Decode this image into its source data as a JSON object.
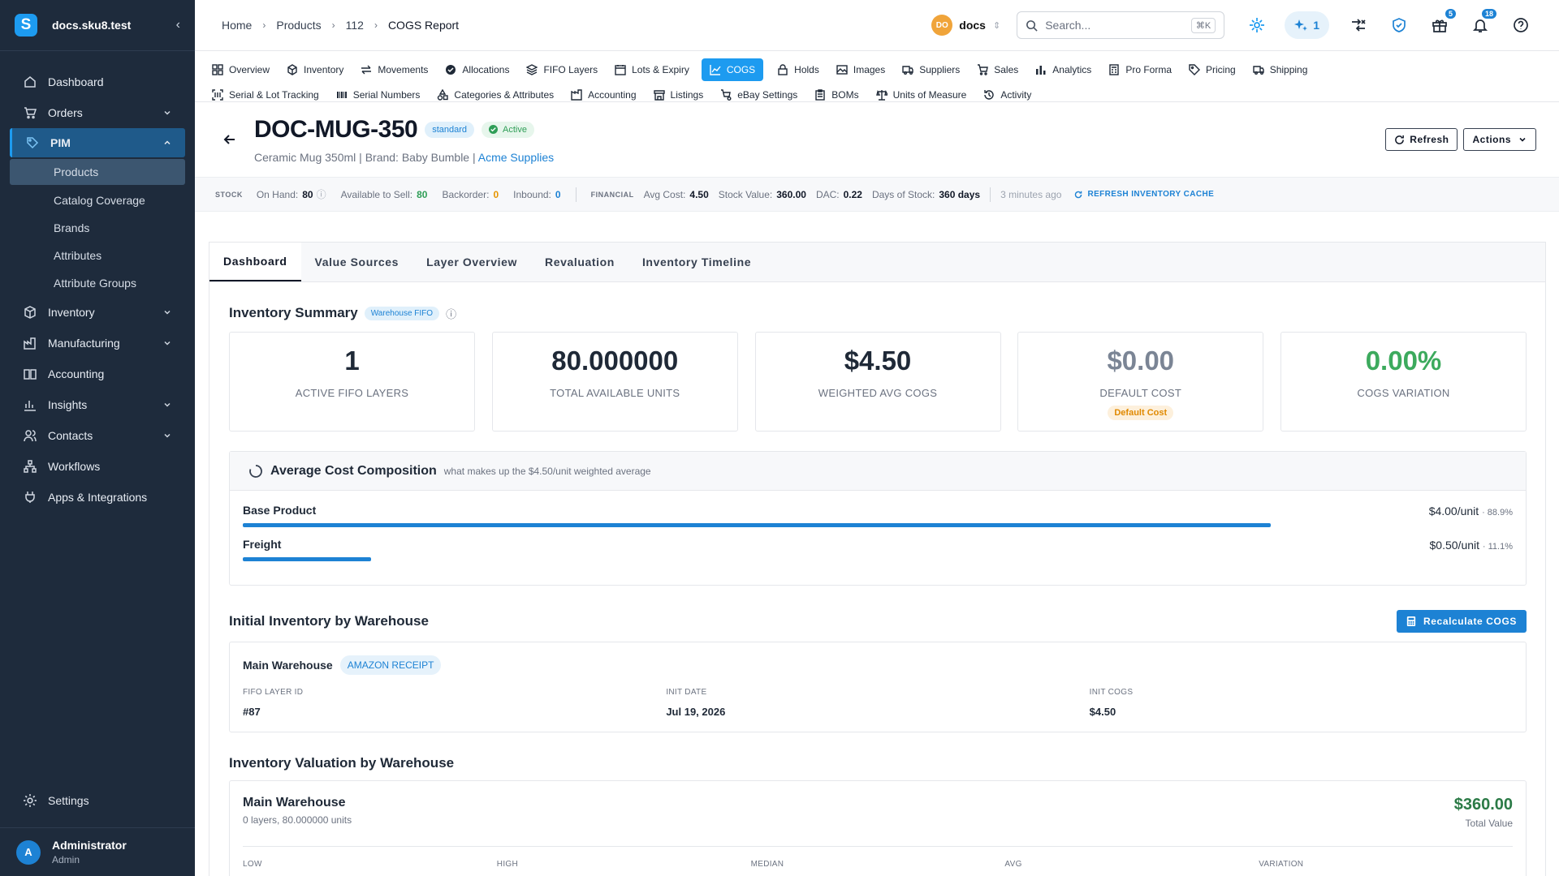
{
  "sidebar": {
    "site": "docs.sku8.test",
    "logo_letter": "S",
    "items": [
      {
        "label": "Dashboard"
      },
      {
        "label": "Orders"
      },
      {
        "label": "PIM"
      },
      {
        "label": "Inventory"
      },
      {
        "label": "Manufacturing"
      },
      {
        "label": "Accounting"
      },
      {
        "label": "Insights"
      },
      {
        "label": "Contacts"
      },
      {
        "label": "Workflows"
      },
      {
        "label": "Apps & Integrations"
      }
    ],
    "pim_sub": [
      "Products",
      "Catalog Coverage",
      "Brands",
      "Attributes",
      "Attribute Groups"
    ],
    "settings": "Settings",
    "user": {
      "initial": "A",
      "name": "Administrator",
      "role": "Admin"
    }
  },
  "topbar": {
    "breadcrumbs": [
      "Home",
      "Products",
      "112",
      "COGS Report"
    ],
    "org_initials": "DO",
    "org": "docs",
    "search_placeholder": "Search...",
    "search_kbd": "⌘K",
    "ai_count": "1",
    "gift_badge": "5",
    "bell_badge": "18"
  },
  "product_tabs": {
    "row1": [
      "Overview",
      "Inventory",
      "Movements",
      "Allocations",
      "FIFO Layers",
      "Lots & Expiry",
      "COGS",
      "Holds",
      "Images",
      "Suppliers",
      "Sales",
      "Analytics",
      "Pro Forma",
      "Pricing",
      "Shipping"
    ],
    "row2": [
      "Serial & Lot Tracking",
      "Serial Numbers",
      "Categories & Attributes",
      "Accounting",
      "Listings",
      "eBay Settings",
      "BOMs",
      "Units of Measure",
      "Activity"
    ]
  },
  "product": {
    "sku": "DOC-MUG-350",
    "type_chip": "standard",
    "status_chip": "Active",
    "name": "Ceramic Mug 350ml",
    "brand": "Brand: Baby Bumble",
    "supplier": "Acme Supplies",
    "refresh_label": "Refresh",
    "actions_label": "Actions"
  },
  "stats": {
    "stock_label": "STOCK",
    "on_hand_label": "On Hand:",
    "on_hand": "80",
    "available_label": "Available to Sell:",
    "available": "80",
    "backorder_label": "Backorder:",
    "backorder": "0",
    "inbound_label": "Inbound:",
    "inbound": "0",
    "financial_label": "FINANCIAL",
    "avg_cost_label": "Avg Cost:",
    "avg_cost": "4.50",
    "stock_value_label": "Stock Value:",
    "stock_value": "360.00",
    "dac_label": "DAC:",
    "dac": "0.22",
    "days_label": "Days of Stock:",
    "days": "360 days",
    "updated": "3 minutes ago",
    "refresh_cache": "REFRESH INVENTORY CACHE"
  },
  "inner_tabs": [
    "Dashboard",
    "Value Sources",
    "Layer Overview",
    "Revaluation",
    "Inventory Timeline"
  ],
  "summary": {
    "title": "Inventory Summary",
    "chip": "Warehouse FIFO",
    "cards": [
      {
        "value": "1",
        "label": "ACTIVE FIFO LAYERS"
      },
      {
        "value": "80.000000",
        "label": "TOTAL AVAILABLE UNITS"
      },
      {
        "value": "$4.50",
        "label": "WEIGHTED AVG COGS"
      },
      {
        "value": "$0.00",
        "label": "DEFAULT COST",
        "chip": "Default Cost"
      },
      {
        "value": "0.00%",
        "label": "COGS VARIATION"
      }
    ]
  },
  "composition": {
    "title": "Average Cost Composition",
    "subtitle": "what makes up the $4.50/unit weighted average",
    "rows": [
      {
        "label": "Base Product",
        "value": "$4.00/unit",
        "pct": "· 88.9%",
        "share": 0.889
      },
      {
        "label": "Freight",
        "value": "$0.50/unit",
        "pct": "· 11.1%",
        "share": 0.111
      }
    ]
  },
  "initial_inventory": {
    "title": "Initial Inventory by Warehouse",
    "button": "Recalculate COGS",
    "warehouse": "Main Warehouse",
    "chip": "AMAZON RECEIPT",
    "fields": [
      {
        "label": "FIFO LAYER ID",
        "value": "#87"
      },
      {
        "label": "INIT DATE",
        "value": "Jul 19, 2026"
      },
      {
        "label": "INIT COGS",
        "value": "$4.50"
      }
    ]
  },
  "valuation": {
    "title": "Inventory Valuation by Warehouse",
    "warehouse": "Main Warehouse",
    "sub": "0 layers, 80.000000 units",
    "total": "$360.00",
    "total_label": "Total Value",
    "columns": [
      "LOW",
      "HIGH",
      "MEDIAN",
      "AVG",
      "VARIATION"
    ]
  },
  "colors": {
    "sidebar_bg": "#1e2b3c",
    "accent": "#1d9bf0",
    "success": "#2f9e57"
  }
}
